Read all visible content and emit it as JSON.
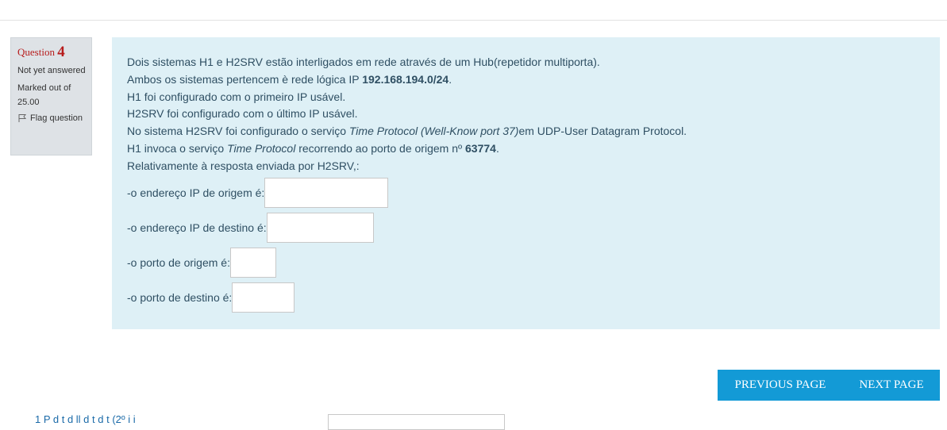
{
  "question_info": {
    "question_label": "Question",
    "question_number": "4",
    "state": "Not yet answered",
    "marked_out_of": "Marked out of 25.00",
    "flag_label": "Flag question"
  },
  "question_text": {
    "line1": "Dois sistemas H1 e H2SRV estão interligados em rede através de um Hub(repetidor multiporta).",
    "line2_pre": "Ambos os sistemas pertencem è rede lógica IP ",
    "line2_bold": "192.168.194.0/24",
    "line2_post": ".",
    "line3": "H1 foi configurado com o primeiro IP usável.",
    "line4": "H2SRV foi configurado com o último IP usável.",
    "line5_pre": "No sistema H2SRV foi configurado o serviço ",
    "line5_italic": "Time Protocol (Well-Know port 37)",
    "line5_post": "em UDP-User Datagram Protocol.",
    "line6_pre": "H1 invoca o serviço ",
    "line6_italic": "Time Protocol",
    "line6_mid": " recorrendo ao porto de origem nº ",
    "line6_bold": "63774",
    "line6_post": ".",
    "line7": "Relativamente à resposta enviada por H2SRV,:"
  },
  "answers": [
    {
      "label": "-o endereço IP de origem é:",
      "value": ""
    },
    {
      "label": "-o endereço IP de destino é:",
      "value": ""
    },
    {
      "label": "-o porto de origem é:",
      "value": ""
    },
    {
      "label": "-o porto de destino é:",
      "value": ""
    }
  ],
  "navigation": {
    "previous_label": "PREVIOUS PAGE",
    "next_label": "NEXT PAGE"
  },
  "footer": {
    "partial_text": "1 P   d   t  d ll d   t d t (2º   i i"
  },
  "colors": {
    "info_bg": "#dee2e6",
    "content_bg": "#def0f6",
    "question_red": "#b71c1c",
    "button_blue": "#139ad6"
  }
}
